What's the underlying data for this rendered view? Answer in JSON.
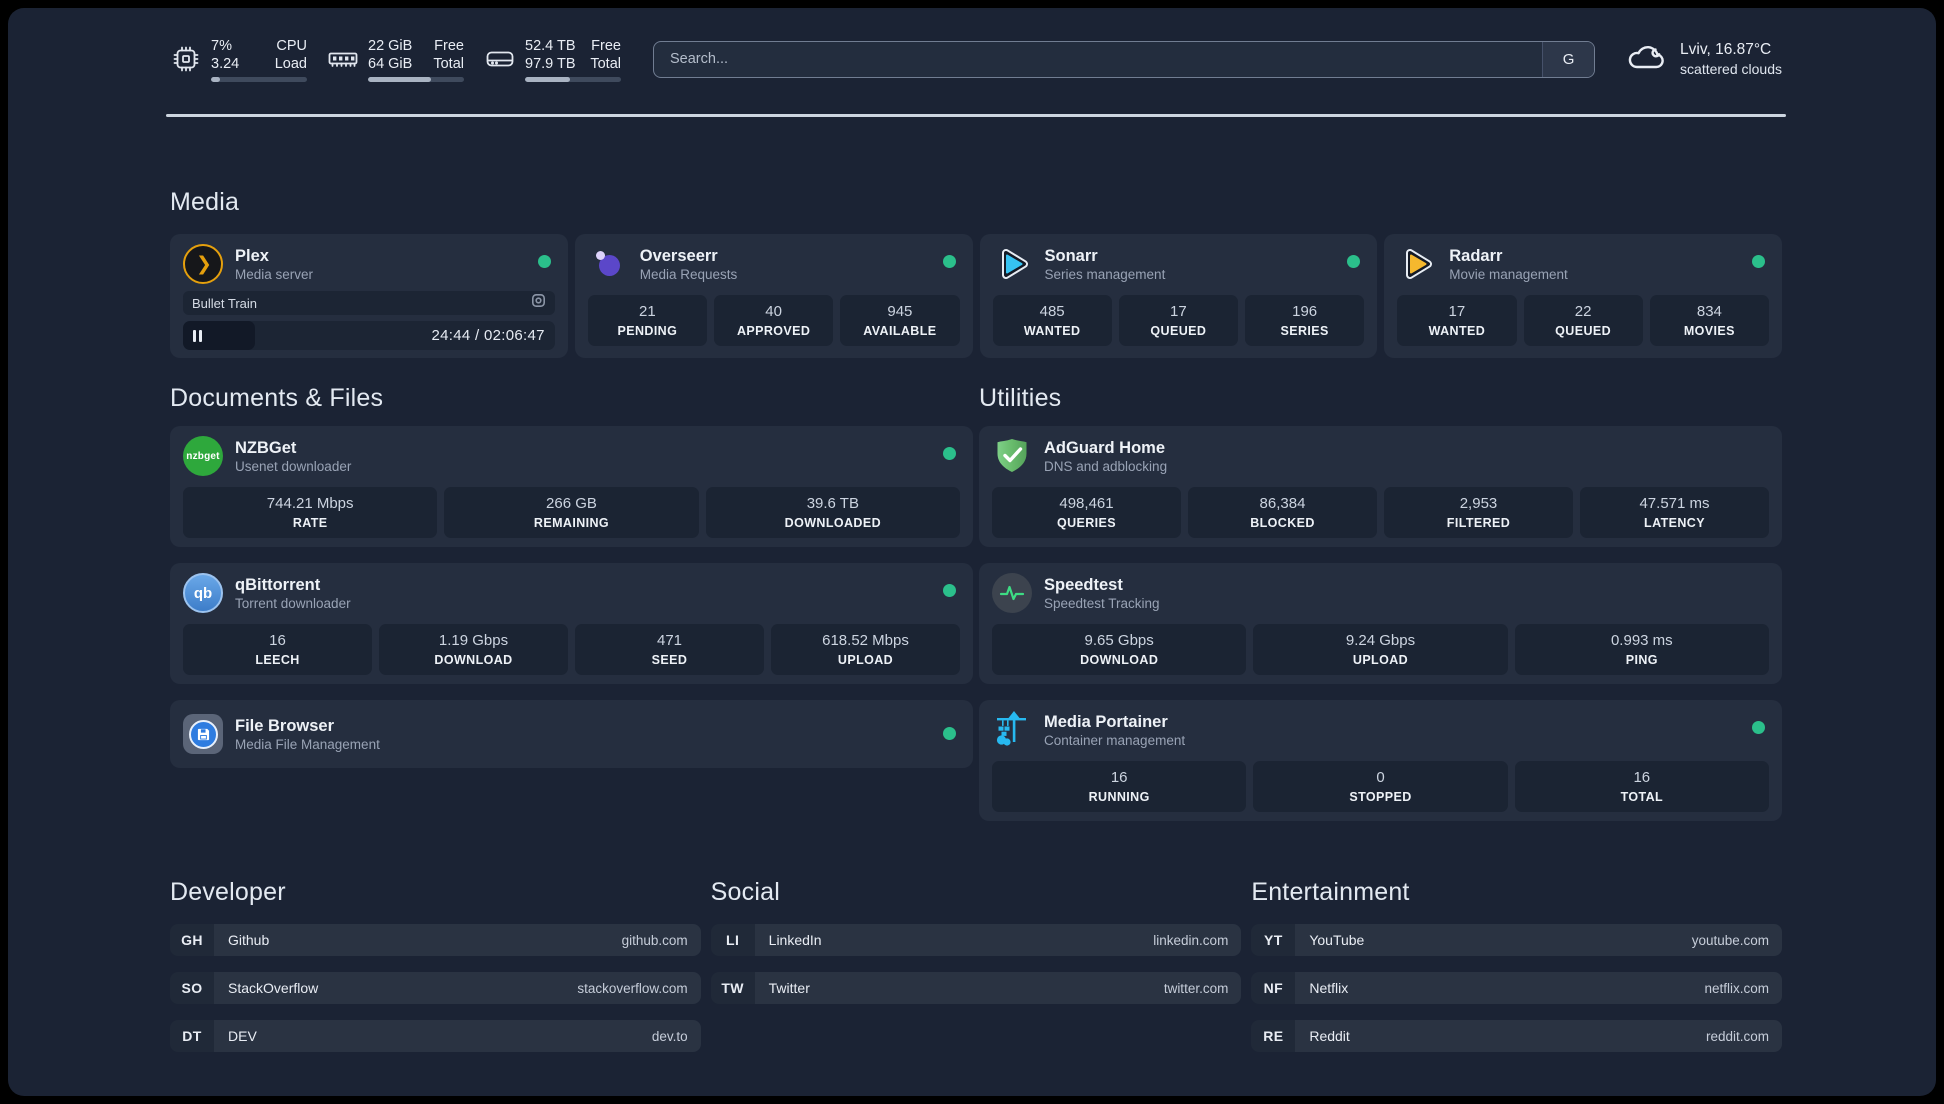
{
  "colors": {
    "page_bg": "#1b2334",
    "card_bg": "#252e3f",
    "tile_bg": "#1b2433",
    "row_bg": "#1c2534",
    "row_fill": "#121927",
    "badge_bg": "#202938",
    "bm_bg": "#2a3342",
    "divider": "#cdd5e0",
    "text_primary": "#e9edf4",
    "text_secondary": "#99a3b5",
    "stat_value": "#ccd4e0",
    "status_green": "#2bbf8b",
    "track": "#3f4a5d",
    "track_fill": "#a9b3c2"
  },
  "topbar": {
    "stats": [
      {
        "icon": "cpu-icon",
        "rows": [
          {
            "value": "7%",
            "label": "CPU"
          },
          {
            "value": "3.24",
            "label": "Load"
          }
        ],
        "progress": 9
      },
      {
        "icon": "memory-icon",
        "rows": [
          {
            "value": "22 GiB",
            "label": "Free"
          },
          {
            "value": "64 GiB",
            "label": "Total"
          }
        ],
        "progress": 66
      },
      {
        "icon": "disk-icon",
        "rows": [
          {
            "value": "52.4 TB",
            "label": "Free"
          },
          {
            "value": "97.9 TB",
            "label": "Total"
          }
        ],
        "progress": 47
      }
    ],
    "search": {
      "placeholder": "Search...",
      "provider_label": "G"
    },
    "weather": {
      "icon": "cloud-icon",
      "line1": "Lviv, 16.87°C",
      "line2": "scattered clouds"
    }
  },
  "sections": {
    "media": {
      "title": "Media",
      "cards": [
        {
          "icon": "plex-icon",
          "title": "Plex",
          "subtitle": "Media server",
          "status": "online",
          "player": {
            "track": "Bullet Train",
            "time": "24:44 / 02:06:47",
            "progress_pct": 19.5
          }
        },
        {
          "icon": "overseerr-icon",
          "title": "Overseerr",
          "subtitle": "Media Requests",
          "status": "online",
          "stats": [
            {
              "value": "21",
              "label": "PENDING"
            },
            {
              "value": "40",
              "label": "APPROVED"
            },
            {
              "value": "945",
              "label": "AVAILABLE"
            }
          ]
        },
        {
          "icon": "sonarr-icon",
          "title": "Sonarr",
          "subtitle": "Series management",
          "status": "online",
          "stats": [
            {
              "value": "485",
              "label": "WANTED"
            },
            {
              "value": "17",
              "label": "QUEUED"
            },
            {
              "value": "196",
              "label": "SERIES"
            }
          ]
        },
        {
          "icon": "radarr-icon",
          "title": "Radarr",
          "subtitle": "Movie management",
          "status": "online",
          "stats": [
            {
              "value": "17",
              "label": "WANTED"
            },
            {
              "value": "22",
              "label": "QUEUED"
            },
            {
              "value": "834",
              "label": "MOVIES"
            }
          ]
        }
      ]
    },
    "documents": {
      "title": "Documents & Files",
      "cards": [
        {
          "icon": "nzbget-icon",
          "title": "NZBGet",
          "subtitle": "Usenet downloader",
          "status": "online",
          "stats": [
            {
              "value": "744.21 Mbps",
              "label": "RATE"
            },
            {
              "value": "266 GB",
              "label": "REMAINING"
            },
            {
              "value": "39.6 TB",
              "label": "DOWNLOADED"
            }
          ]
        },
        {
          "icon": "qbittorrent-icon",
          "title": "qBittorrent",
          "subtitle": "Torrent downloader",
          "status": "online",
          "stats": [
            {
              "value": "16",
              "label": "LEECH"
            },
            {
              "value": "1.19 Gbps",
              "label": "DOWNLOAD"
            },
            {
              "value": "471",
              "label": "SEED"
            },
            {
              "value": "618.52 Mbps",
              "label": "UPLOAD"
            }
          ]
        },
        {
          "icon": "filebrowser-icon",
          "title": "File Browser",
          "subtitle": "Media File Management",
          "status": "online",
          "stats": []
        }
      ]
    },
    "utilities": {
      "title": "Utilities",
      "cards": [
        {
          "icon": "adguard-icon",
          "title": "AdGuard Home",
          "subtitle": "DNS and adblocking",
          "stats": [
            {
              "value": "498,461",
              "label": "QUERIES"
            },
            {
              "value": "86,384",
              "label": "BLOCKED"
            },
            {
              "value": "2,953",
              "label": "FILTERED"
            },
            {
              "value": "47.571 ms",
              "label": "LATENCY"
            }
          ]
        },
        {
          "icon": "speedtest-icon",
          "title": "Speedtest",
          "subtitle": "Speedtest Tracking",
          "stats": [
            {
              "value": "9.65 Gbps",
              "label": "DOWNLOAD"
            },
            {
              "value": "9.24 Gbps",
              "label": "UPLOAD"
            },
            {
              "value": "0.993 ms",
              "label": "PING"
            }
          ]
        },
        {
          "icon": "portainer-icon",
          "title": "Media Portainer",
          "subtitle": "Container management",
          "status": "online",
          "stats": [
            {
              "value": "16",
              "label": "RUNNING"
            },
            {
              "value": "0",
              "label": "STOPPED"
            },
            {
              "value": "16",
              "label": "TOTAL"
            }
          ]
        }
      ]
    },
    "bookmarks": [
      {
        "title": "Developer",
        "items": [
          {
            "abbr": "GH",
            "name": "Github",
            "url": "github.com"
          },
          {
            "abbr": "SO",
            "name": "StackOverflow",
            "url": "stackoverflow.com"
          },
          {
            "abbr": "DT",
            "name": "DEV",
            "url": "dev.to"
          }
        ]
      },
      {
        "title": "Social",
        "items": [
          {
            "abbr": "LI",
            "name": "LinkedIn",
            "url": "linkedin.com"
          },
          {
            "abbr": "TW",
            "name": "Twitter",
            "url": "twitter.com"
          }
        ]
      },
      {
        "title": "Entertainment",
        "items": [
          {
            "abbr": "YT",
            "name": "YouTube",
            "url": "youtube.com"
          },
          {
            "abbr": "NF",
            "name": "Netflix",
            "url": "netflix.com"
          },
          {
            "abbr": "RE",
            "name": "Reddit",
            "url": "reddit.com"
          }
        ]
      }
    ]
  }
}
